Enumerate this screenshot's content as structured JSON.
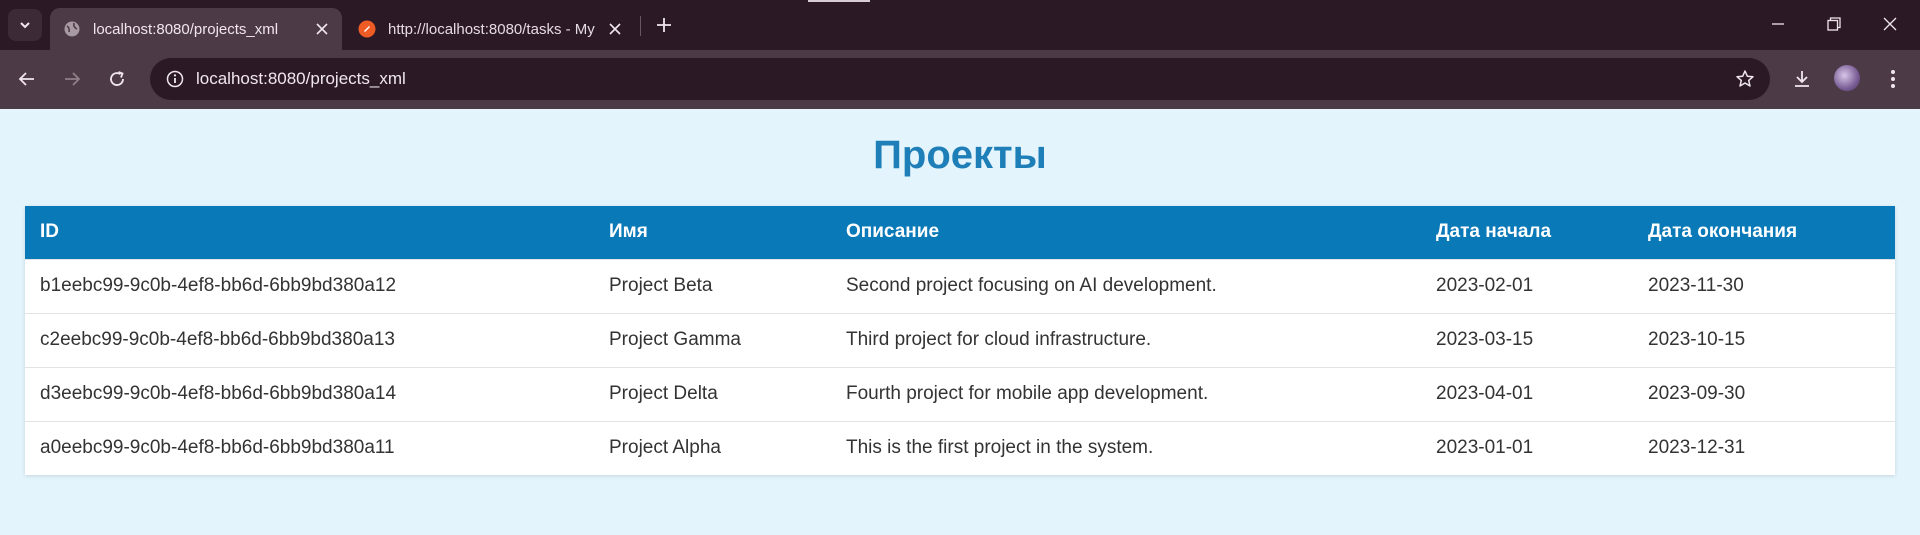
{
  "browser": {
    "tabs": [
      {
        "title": "localhost:8080/projects_xml",
        "active": true,
        "favicon": "globe-icon"
      },
      {
        "title": "http://localhost:8080/tasks - My",
        "active": false,
        "favicon": "postman-icon"
      }
    ],
    "url": "localhost:8080/projects_xml"
  },
  "page": {
    "title": "Проекты",
    "table": {
      "headers": [
        "ID",
        "Имя",
        "Описание",
        "Дата начала",
        "Дата окончания"
      ],
      "rows": [
        [
          "b1eebc99-9c0b-4ef8-bb6d-6bb9bd380a12",
          "Project Beta",
          "Second project focusing on AI development.",
          "2023-02-01",
          "2023-11-30"
        ],
        [
          "c2eebc99-9c0b-4ef8-bb6d-6bb9bd380a13",
          "Project Gamma",
          "Third project for cloud infrastructure.",
          "2023-03-15",
          "2023-10-15"
        ],
        [
          "d3eebc99-9c0b-4ef8-bb6d-6bb9bd380a14",
          "Project Delta",
          "Fourth project for mobile app development.",
          "2023-04-01",
          "2023-09-30"
        ],
        [
          "a0eebc99-9c0b-4ef8-bb6d-6bb9bd380a11",
          "Project Alpha",
          "This is the first project in the system.",
          "2023-01-01",
          "2023-12-31"
        ]
      ]
    }
  },
  "colors": {
    "page_background": "#e3f4fc",
    "title": "#1e7fb8",
    "table_header": "#0a79b8",
    "chrome_dark": "#2b1a26",
    "chrome_light": "#4d3a47"
  }
}
